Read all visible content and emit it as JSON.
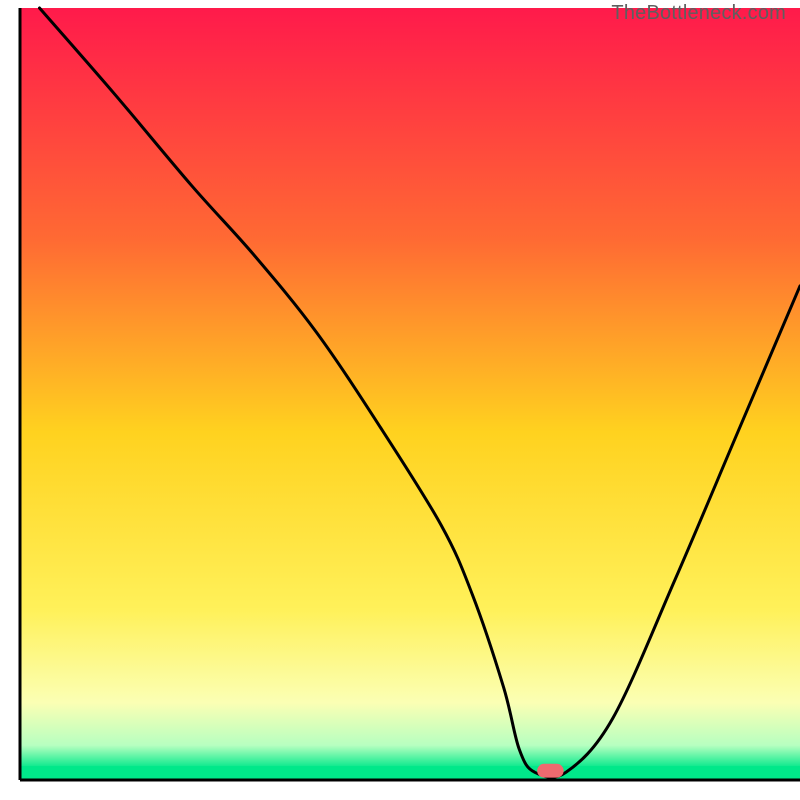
{
  "watermark": {
    "text": "TheBottleneck.com"
  },
  "chart_data": {
    "type": "line",
    "title": "",
    "xlabel": "",
    "ylabel": "",
    "xlim": [
      0,
      100
    ],
    "ylim": [
      0,
      100
    ],
    "grid": false,
    "legend": false,
    "background_gradient_stops": [
      {
        "pos": 0.0,
        "color": "#ff1a4b"
      },
      {
        "pos": 0.3,
        "color": "#ff6a33"
      },
      {
        "pos": 0.55,
        "color": "#ffd21f"
      },
      {
        "pos": 0.78,
        "color": "#fff15a"
      },
      {
        "pos": 0.9,
        "color": "#fbffb4"
      },
      {
        "pos": 0.955,
        "color": "#b7ffc0"
      },
      {
        "pos": 0.985,
        "color": "#00e88a"
      },
      {
        "pos": 1.0,
        "color": "#00e88a"
      }
    ],
    "axis_box": {
      "x0": 2.5,
      "y0": 2.5,
      "x1": 100,
      "y1": 99
    },
    "series": [
      {
        "name": "bottleneck-curve",
        "x": [
          2.5,
          12,
          22,
          30,
          38,
          46,
          54,
          58,
          62,
          64,
          66,
          70,
          76,
          84,
          92,
          100
        ],
        "y": [
          100,
          89,
          77,
          68,
          58,
          46,
          33,
          24,
          12,
          4,
          1,
          1,
          8,
          26,
          45,
          64
        ]
      }
    ],
    "marker": {
      "name": "optimal-point",
      "x": 68,
      "y": 1.2,
      "color": "#ef6a6f",
      "shape": "pill",
      "w": 3.4,
      "h": 1.8
    }
  }
}
